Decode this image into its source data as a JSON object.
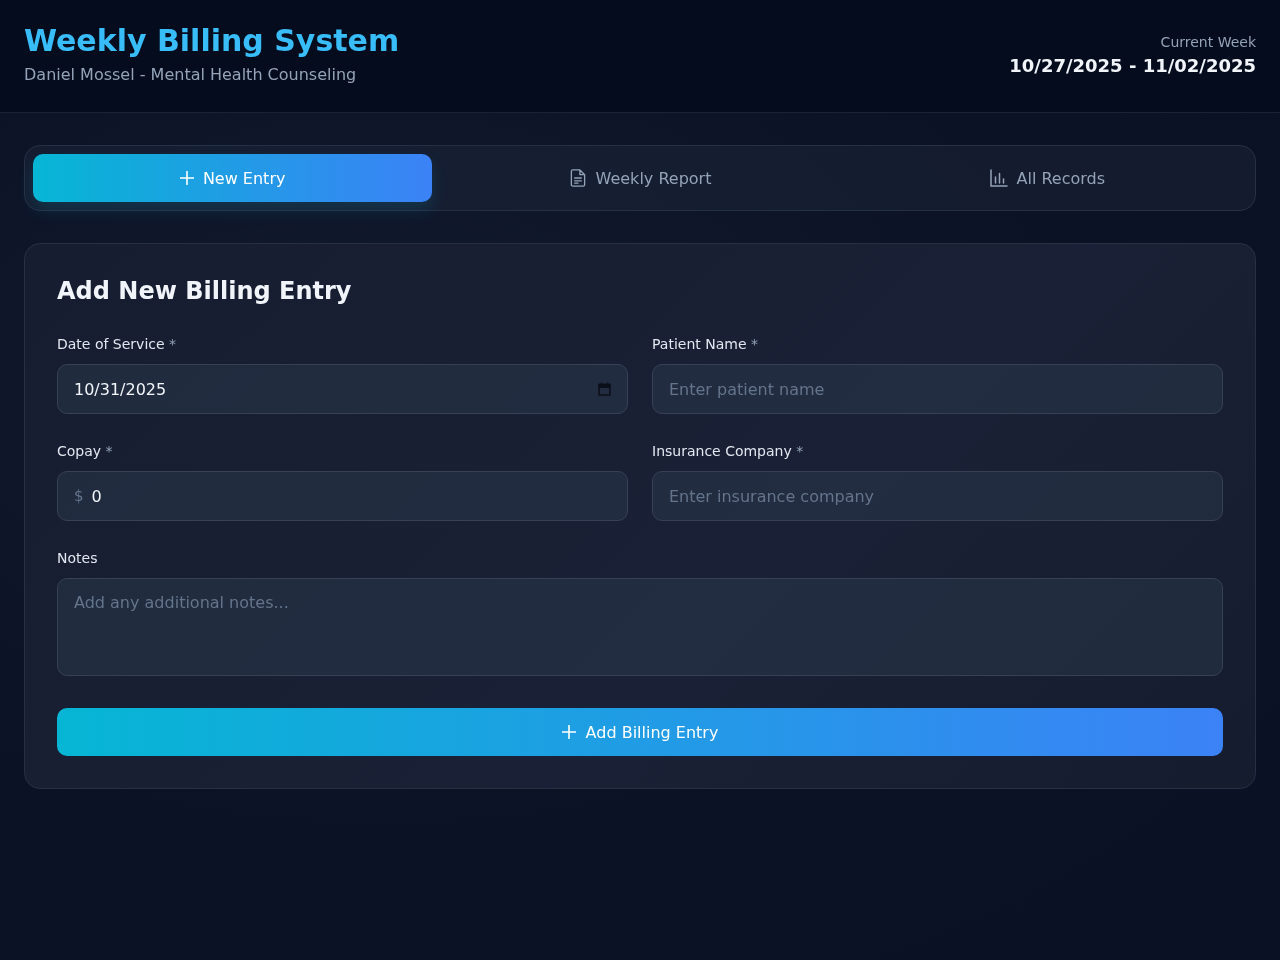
{
  "header": {
    "title": "Weekly Billing System",
    "subtitle": "Daniel Mossel - Mental Health Counseling",
    "week_label": "Current Week",
    "week_range": "10/27/2025 - 11/02/2025"
  },
  "tabs": [
    {
      "label": "New Entry",
      "selected": true
    },
    {
      "label": "Weekly Report",
      "selected": false
    },
    {
      "label": "All Records",
      "selected": false
    }
  ],
  "form": {
    "title": "Add New Billing Entry",
    "fields": [
      {
        "kind": "date",
        "label": "Date of Service",
        "required_mark": "*",
        "value": "10/31/2025"
      },
      {
        "kind": "text",
        "label": "Patient Name",
        "required_mark": "*",
        "placeholder": "Enter patient name"
      },
      {
        "kind": "money",
        "label": "Copay",
        "required_mark": "*",
        "prefix": "$",
        "value": "0"
      },
      {
        "kind": "text",
        "label": "Insurance Company",
        "required_mark": "*",
        "placeholder": "Enter insurance company"
      },
      {
        "kind": "textarea",
        "label": "Notes",
        "placeholder": "Add any additional notes..."
      }
    ],
    "submit": {
      "label": "Add Billing Entry"
    }
  }
}
